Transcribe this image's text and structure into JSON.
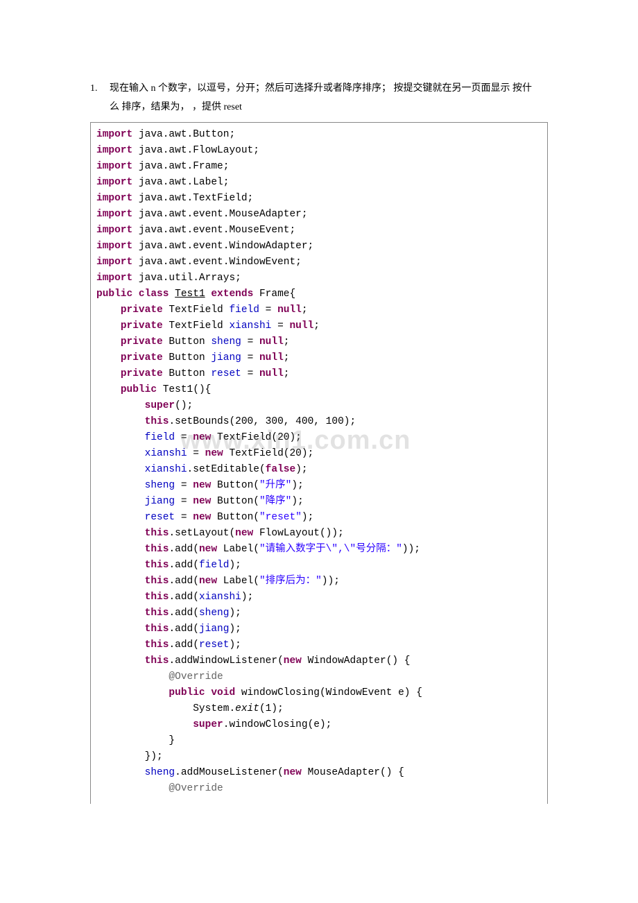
{
  "question": {
    "num": "1.",
    "line1": "现在输入 n 个数字，以逗号，分开；然后可选择升或者降序排序；  按提交键就在另一页面显示 按什",
    "line2": "么 排序，结果为，  ，提供 reset"
  },
  "watermark": "www.xin1.com.cn",
  "code": {
    "l1a": "import",
    "l1b": " java.awt.Button;",
    "l2a": "import",
    "l2b": " java.awt.FlowLayout;",
    "l3a": "import",
    "l3b": " java.awt.Frame;",
    "l4a": "import",
    "l4b": " java.awt.Label;",
    "l5a": "import",
    "l5b": " java.awt.TextField;",
    "l6a": "import",
    "l6b": " java.awt.event.MouseAdapter;",
    "l7a": "import",
    "l7b": " java.awt.event.MouseEvent;",
    "l8a": "import",
    "l8b": " java.awt.event.WindowAdapter;",
    "l9a": "import",
    "l9b": " java.awt.event.WindowEvent;",
    "l10a": "import",
    "l10b": " java.util.Arrays;",
    "l11a": "public",
    "l11b": "class",
    "l11c": "Test1",
    "l11d": "extends",
    "l11e": " Frame{",
    "l12a": "private",
    "l12b": " TextField ",
    "l12c": "field",
    "l12d": " = ",
    "l12e": "null",
    "l12f": ";",
    "l13a": "private",
    "l13b": " TextField ",
    "l13c": "xianshi",
    "l13d": " = ",
    "l13e": "null",
    "l13f": ";",
    "l14a": "private",
    "l14b": " Button ",
    "l14c": "sheng",
    "l14d": " = ",
    "l14e": "null",
    "l14f": ";",
    "l15a": "private",
    "l15b": " Button ",
    "l15c": "jiang",
    "l15d": " = ",
    "l15e": "null",
    "l15f": ";",
    "l16a": "private",
    "l16b": " Button ",
    "l16c": "reset",
    "l16d": " = ",
    "l16e": "null",
    "l16f": ";",
    "l17a": "public",
    "l17b": " Test1(){",
    "l18a": "super",
    "l18b": "();",
    "l19a": "this",
    "l19b": ".setBounds(200, 300, 400, 100);",
    "l20a": "field",
    "l20b": " = ",
    "l20c": "new",
    "l20d": " TextField(20);",
    "l21a": "xianshi",
    "l21b": " = ",
    "l21c": "new",
    "l21d": " TextField(20);",
    "l22a": "xianshi",
    "l22b": ".setEditable(",
    "l22c": "false",
    "l22d": ");",
    "l23a": "sheng",
    "l23b": " = ",
    "l23c": "new",
    "l23d": " Button(",
    "l23e": "\"升序\"",
    "l23f": ");",
    "l24a": "jiang",
    "l24b": " = ",
    "l24c": "new",
    "l24d": " Button(",
    "l24e": "\"降序\"",
    "l24f": ");",
    "l25a": "reset",
    "l25b": " = ",
    "l25c": "new",
    "l25d": " Button(",
    "l25e": "\"reset\"",
    "l25f": ");",
    "l26a": "this",
    "l26b": ".setLayout(",
    "l26c": "new",
    "l26d": " FlowLayout());",
    "l27a": "this",
    "l27b": ".add(",
    "l27c": "new",
    "l27d": " Label(",
    "l27e": "\"请输入数字于\\\",\\\"号分隔：\"",
    "l27f": "));",
    "l28a": "this",
    "l28b": ".add(",
    "l28c": "field",
    "l28d": ");",
    "l29a": "this",
    "l29b": ".add(",
    "l29c": "new",
    "l29d": " Label(",
    "l29e": "\"排序后为：\"",
    "l29f": "));",
    "l30a": "this",
    "l30b": ".add(",
    "l30c": "xianshi",
    "l30d": ");",
    "l31a": "this",
    "l31b": ".add(",
    "l31c": "sheng",
    "l31d": ");",
    "l32a": "this",
    "l32b": ".add(",
    "l32c": "jiang",
    "l32d": ");",
    "l33a": "this",
    "l33b": ".add(",
    "l33c": "reset",
    "l33d": ");",
    "l34a": "this",
    "l34b": ".addWindowListener(",
    "l34c": "new",
    "l34d": " WindowAdapter() {",
    "l35a": "@Override",
    "l36a": "public",
    "l36b": "void",
    "l36c": " windowClosing(WindowEvent e) {",
    "l37a": "System.",
    "l37b": "exit",
    "l37c": "(1);",
    "l38a": "super",
    "l38b": ".windowClosing(e);",
    "l39a": "}",
    "l40a": "});",
    "l41a": "sheng",
    "l41b": ".addMouseListener(",
    "l41c": "new",
    "l41d": " MouseAdapter() {",
    "l42a": "@Override"
  }
}
